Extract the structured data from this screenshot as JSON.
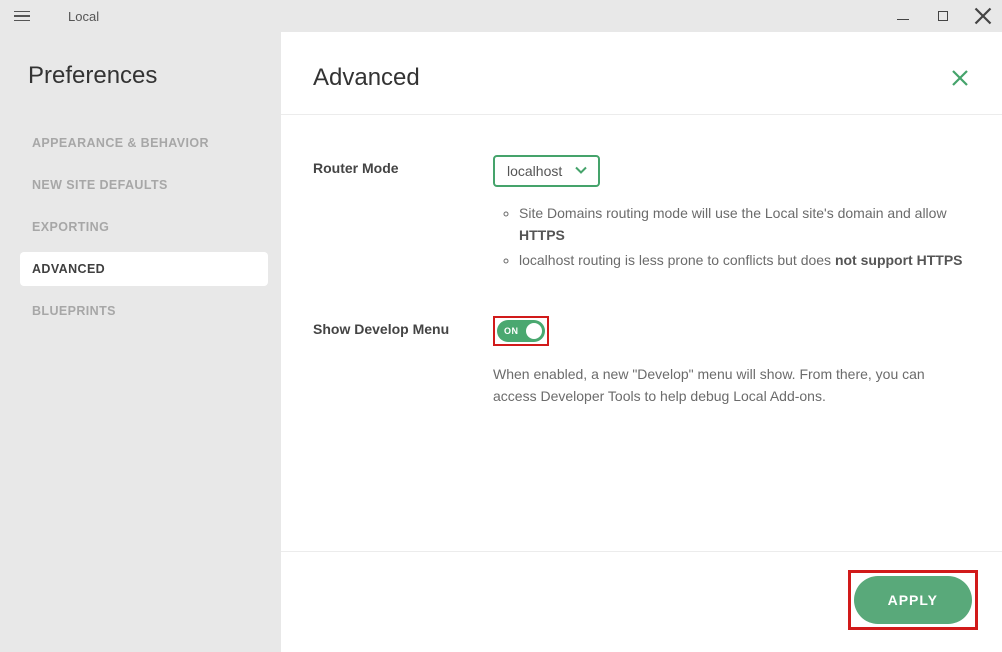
{
  "window": {
    "title": "Local"
  },
  "sidebar": {
    "heading": "Preferences",
    "items": [
      {
        "label": "APPEARANCE & BEHAVIOR",
        "active": false
      },
      {
        "label": "NEW SITE DEFAULTS",
        "active": false
      },
      {
        "label": "EXPORTING",
        "active": false
      },
      {
        "label": "ADVANCED",
        "active": true
      },
      {
        "label": "BLUEPRINTS",
        "active": false
      }
    ]
  },
  "main": {
    "title": "Advanced",
    "router_mode": {
      "label": "Router Mode",
      "selected": "localhost",
      "hints": {
        "line1_pre": "Site Domains routing mode will use the Local site's domain and allow ",
        "line1_bold": "HTTPS",
        "line2_pre": "localhost routing is less prone to conflicts but does ",
        "line2_bold": "not support HTTPS"
      }
    },
    "develop_menu": {
      "label": "Show Develop Menu",
      "state": "ON",
      "description": "When enabled, a new \"Develop\" menu will show. From there, you can access Developer Tools to help debug Local Add-ons."
    }
  },
  "footer": {
    "apply_label": "APPLY"
  }
}
